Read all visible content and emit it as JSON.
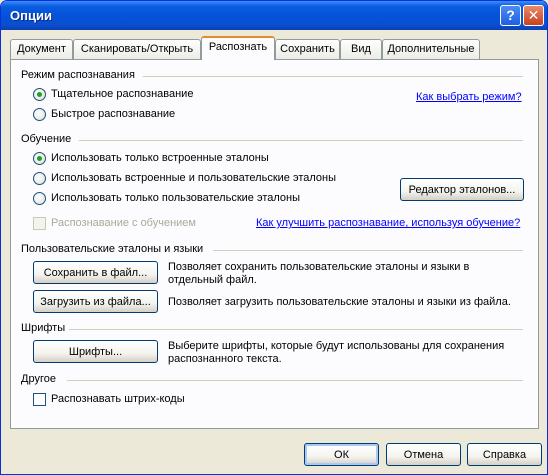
{
  "window": {
    "title": "Опции",
    "help_glyph": "?",
    "close_glyph": "✕"
  },
  "tabs": [
    {
      "label": "Документ"
    },
    {
      "label": "Сканировать/Открыть"
    },
    {
      "label": "Распознать"
    },
    {
      "label": "Сохранить"
    },
    {
      "label": "Вид"
    },
    {
      "label": "Дополнительные"
    }
  ],
  "recognition_mode": {
    "title": "Режим распознавания",
    "thorough": "Тщательное распознавание",
    "fast": "Быстрое распознавание",
    "help_link": "Как выбрать режим?",
    "selected": "thorough"
  },
  "training": {
    "title": "Обучение",
    "builtin_only": "Использовать только встроенные эталоны",
    "builtin_and_user": "Использовать встроенные и пользовательские эталоны",
    "user_only": "Использовать только пользовательские эталоны",
    "editor_button": "Редактор эталонов...",
    "with_training": "Распознавание с обучением",
    "help_link": "Как улучшить распознавание, используя обучение?",
    "selected": "builtin_only"
  },
  "user_patterns": {
    "title": "Пользовательские эталоны и языки",
    "save_button": "Сохранить в файл...",
    "save_desc_1": "Позволяет сохранить пользовательские эталоны и языки в",
    "save_desc_2": "отдельный файл.",
    "load_button": "Загрузить из файла...",
    "load_desc": "Позволяет загрузить пользовательские эталоны и языки из файла."
  },
  "fonts": {
    "title": "Шрифты",
    "button": "Шрифты...",
    "desc_1": "Выберите шрифты, которые будут использованы для сохранения",
    "desc_2": "распознанного текста."
  },
  "other": {
    "title": "Другое",
    "barcodes": "Распознавать штрих-коды"
  },
  "footer": {
    "ok": "ОК",
    "cancel": "Отмена",
    "help": "Справка"
  },
  "colors": {
    "title_bar": "#0453d9",
    "link": "#0000ff",
    "active_tab_accent": "#e68b2c",
    "radio_dot": "#21a121"
  }
}
